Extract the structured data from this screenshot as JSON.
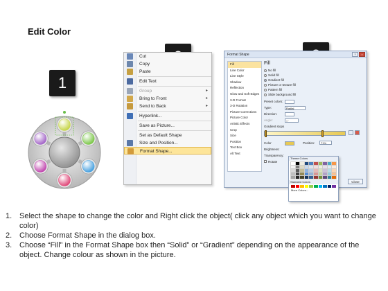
{
  "title": "Edit Color",
  "steps_labels": [
    "1",
    "2",
    "3"
  ],
  "context_menu": {
    "items": [
      {
        "label": "Cut",
        "icon": "scissors-icon",
        "color": "#6a88b8",
        "disabled": false,
        "submenu": false,
        "sep_after": false
      },
      {
        "label": "Copy",
        "icon": "copy-icon",
        "color": "#6d87ad",
        "disabled": false,
        "submenu": false,
        "sep_after": false
      },
      {
        "label": "Paste",
        "icon": "paste-icon",
        "color": "#c6a042",
        "disabled": false,
        "submenu": false,
        "sep_after": true
      },
      {
        "label": "Edit Text",
        "icon": "edit-text-icon",
        "color": "#4c6aa0",
        "disabled": false,
        "submenu": false,
        "sep_after": true
      },
      {
        "label": "Group",
        "icon": "group-icon",
        "color": "#9aa6b8",
        "disabled": true,
        "submenu": true,
        "sep_after": false
      },
      {
        "label": "Bring to Front",
        "icon": "bring-front-icon",
        "color": "#d2a84a",
        "disabled": false,
        "submenu": true,
        "sep_after": false
      },
      {
        "label": "Send to Back",
        "icon": "send-back-icon",
        "color": "#c69a3e",
        "disabled": false,
        "submenu": true,
        "sep_after": true
      },
      {
        "label": "Hyperlink...",
        "icon": "hyperlink-icon",
        "color": "#3f6fb6",
        "disabled": false,
        "submenu": false,
        "sep_after": true
      },
      {
        "label": "Save as Picture...",
        "icon": "",
        "color": "",
        "disabled": false,
        "submenu": false,
        "sep_after": true
      },
      {
        "label": "Set as Default Shape",
        "icon": "",
        "color": "",
        "disabled": false,
        "submenu": false,
        "sep_after": false
      },
      {
        "label": "Size and Position...",
        "icon": "size-position-icon",
        "color": "#5a78a8",
        "disabled": false,
        "submenu": false,
        "sep_after": false
      },
      {
        "label": "Format Shape...",
        "icon": "format-shape-icon",
        "color": "#d29a3a",
        "disabled": false,
        "submenu": false,
        "sep_after": false,
        "highlighted": true
      }
    ]
  },
  "dialog": {
    "title": "Format Shape",
    "left_items": [
      "Fill",
      "Line Color",
      "Line Style",
      "Shadow",
      "Reflection",
      "Glow and Soft Edges",
      "3-D Format",
      "3-D Rotation",
      "Picture Corrections",
      "Picture Color",
      "Artistic Effects",
      "Crop",
      "Size",
      "Position",
      "Text Box",
      "Alt Text"
    ],
    "selected_index": 0,
    "heading": "Fill",
    "fill_options": [
      "No fill",
      "Solid fill",
      "Gradient fill",
      "Picture or texture fill",
      "Pattern fill",
      "Slide background fill"
    ],
    "fill_selected": 2,
    "preset_label": "Preset colors:",
    "type_label": "Type:",
    "type_value": "Radial",
    "direction_label": "Direction:",
    "angle_label": "Angle:",
    "angle_value": "0°",
    "stops_label": "Gradient stops",
    "color_label": "Color",
    "position_label": "Position:",
    "position_value": "71%",
    "brightness_label": "Brightness:",
    "transparency_label": "Transparency:",
    "rotate_label": "Rotate",
    "close_label": "Close"
  },
  "palette": {
    "theme_label": "Theme Colors",
    "standard_label": "Standard Colors",
    "more_label": "More Colors...",
    "theme_colors": [
      "#ffffff",
      "#000000",
      "#eeece1",
      "#1f497d",
      "#4f81bd",
      "#c0504d",
      "#9bbb59",
      "#8064a2",
      "#4bacc6",
      "#f79646",
      "#f2f2f2",
      "#7f7f7f",
      "#ddd9c3",
      "#c6d9f0",
      "#dbe5f1",
      "#f2dcdb",
      "#ebf1dd",
      "#e5e0ec",
      "#dbeef3",
      "#fdeada",
      "#d8d8d8",
      "#595959",
      "#c4bd97",
      "#8db3e2",
      "#b8cce4",
      "#e5b9b7",
      "#d7e3bc",
      "#ccc1d9",
      "#b7dde8",
      "#fbd5b5",
      "#bfbfbf",
      "#3f3f3f",
      "#938953",
      "#548dd4",
      "#95b3d7",
      "#d99694",
      "#c3d69b",
      "#b2a2c7",
      "#92cddc",
      "#fac08f",
      "#a5a5a5",
      "#262626",
      "#494429",
      "#17365d",
      "#366092",
      "#953734",
      "#76923c",
      "#5f497a",
      "#31859b",
      "#e36c09"
    ],
    "standard_colors": [
      "#c00000",
      "#ff0000",
      "#ffc000",
      "#ffff00",
      "#92d050",
      "#00b050",
      "#00b0f0",
      "#0070c0",
      "#002060",
      "#7030a0"
    ]
  },
  "diagram": {
    "balls": [
      "#c7d64a",
      "#7ec84c",
      "#4aa2e0",
      "#e04a7a",
      "#c24ab0",
      "#a568c9"
    ]
  },
  "instructions": [
    {
      "num": "1.",
      "text": "Select the shape to change the color and Right click the object( click any object which you want to change color)"
    },
    {
      "num": "2.",
      "text": "Choose Format Shape in the dialog box."
    },
    {
      "num": "3.",
      "text": "Choose “Fill” in the Format Shape box then “Solid” or “Gradient” depending on the appearance of the object. Change colour as shown in the picture."
    }
  ]
}
